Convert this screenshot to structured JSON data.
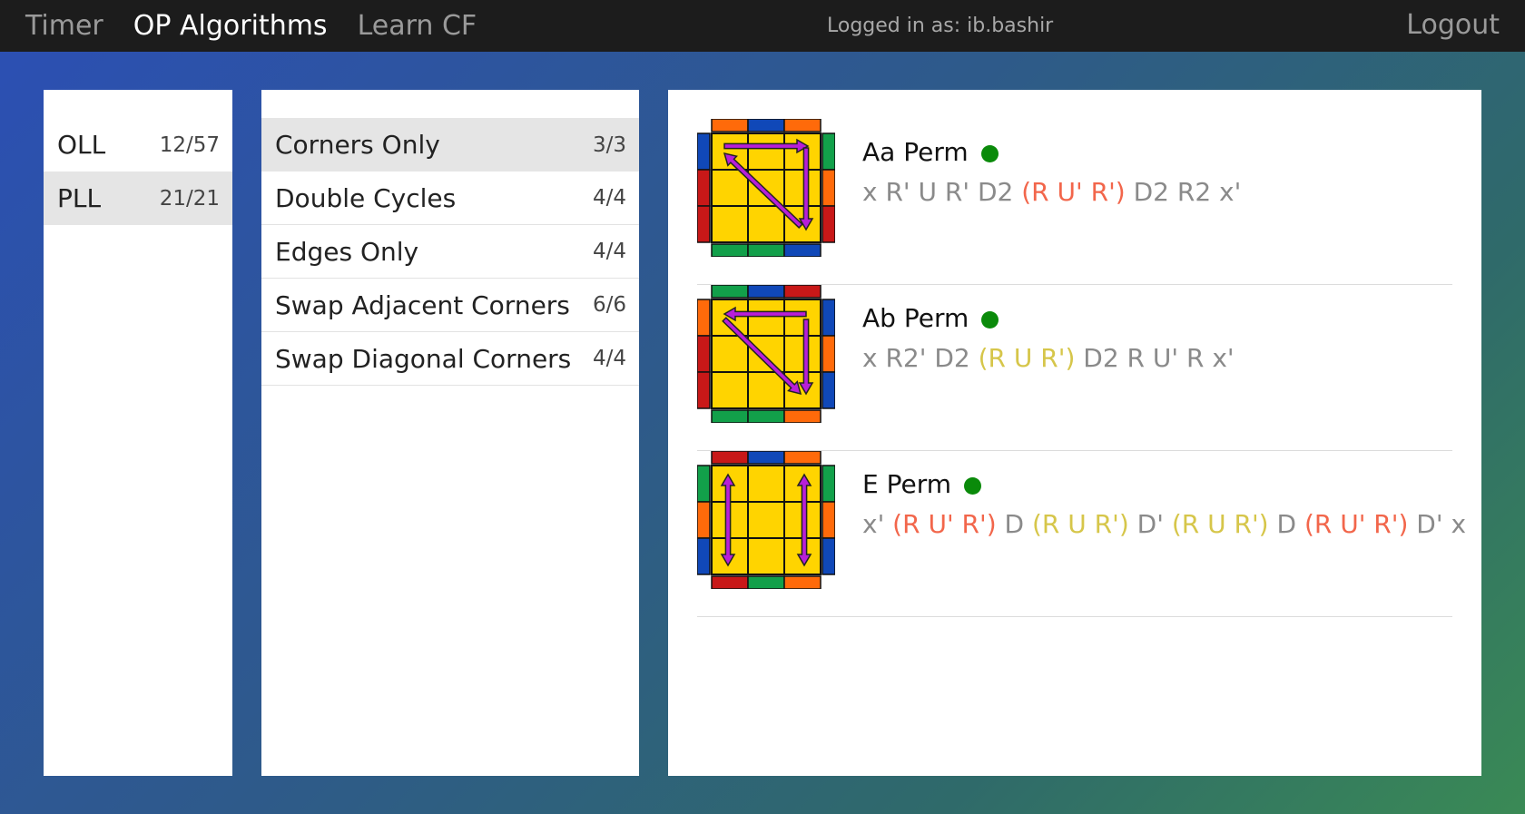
{
  "nav": {
    "items": [
      {
        "label": "Timer",
        "active": false
      },
      {
        "label": "OP Algorithms",
        "active": true
      },
      {
        "label": "Learn CF",
        "active": false
      }
    ],
    "logged_in_text": "Logged in as: ib.bashir",
    "logout_label": "Logout"
  },
  "sets": [
    {
      "name": "OLL",
      "count": "12/57",
      "selected": false
    },
    {
      "name": "PLL",
      "count": "21/21",
      "selected": true
    }
  ],
  "groups": [
    {
      "name": "Corners Only",
      "count": "3/3",
      "selected": true
    },
    {
      "name": "Double Cycles",
      "count": "4/4",
      "selected": false
    },
    {
      "name": "Edges Only",
      "count": "4/4",
      "selected": false
    },
    {
      "name": "Swap Adjacent Corners",
      "count": "6/6",
      "selected": false
    },
    {
      "name": "Swap Diagonal Corners",
      "count": "4/4",
      "selected": false
    }
  ],
  "colors": {
    "status_learned": "#0a8a0a",
    "highlight_orange": "#f2664b",
    "highlight_yellow": "#d6c64a",
    "moves_gray": "#8a8a8a",
    "cube_yellow": "#ffd400",
    "arrow": "#b81fd8",
    "red": "#c81818",
    "orange": "#ff6a0a",
    "blue": "#1048b8",
    "green": "#12a04a"
  },
  "algorithms": [
    {
      "name": "Aa Perm",
      "status_icon": "status-dot-icon",
      "segments": [
        {
          "text": "x R' U R' D2 ",
          "style": "gray"
        },
        {
          "text": "(R U' R')",
          "style": "orange"
        },
        {
          "text": " D2 R2 x'",
          "style": "gray"
        }
      ],
      "stickers": {
        "top": [
          "orange",
          "blue",
          "orange"
        ],
        "left": [
          "blue",
          "red",
          "red"
        ],
        "right": [
          "green",
          "orange",
          "red"
        ],
        "bottom": [
          "green",
          "green",
          "blue"
        ]
      },
      "arrows": "aa"
    },
    {
      "name": "Ab Perm",
      "status_icon": "status-dot-icon",
      "segments": [
        {
          "text": "x R2' D2 ",
          "style": "gray"
        },
        {
          "text": "(R U R')",
          "style": "yellow"
        },
        {
          "text": " D2 R U' R x'",
          "style": "gray"
        }
      ],
      "stickers": {
        "top": [
          "green",
          "blue",
          "red"
        ],
        "left": [
          "orange",
          "red",
          "red"
        ],
        "right": [
          "blue",
          "orange",
          "blue"
        ],
        "bottom": [
          "green",
          "green",
          "orange"
        ]
      },
      "arrows": "ab"
    },
    {
      "name": "E Perm",
      "status_icon": "status-dot-icon",
      "segments": [
        {
          "text": "x' ",
          "style": "gray"
        },
        {
          "text": "(R U' R')",
          "style": "orange"
        },
        {
          "text": " D ",
          "style": "gray"
        },
        {
          "text": "(R U R')",
          "style": "yellow"
        },
        {
          "text": " D' ",
          "style": "gray"
        },
        {
          "text": "(R U R')",
          "style": "yellow"
        },
        {
          "text": " D ",
          "style": "gray"
        },
        {
          "text": "(R U' R')",
          "style": "orange"
        },
        {
          "text": " D' x",
          "style": "gray"
        }
      ],
      "stickers": {
        "top": [
          "red",
          "blue",
          "orange"
        ],
        "left": [
          "green",
          "orange",
          "blue"
        ],
        "right": [
          "green",
          "orange",
          "blue"
        ],
        "bottom": [
          "red",
          "green",
          "orange"
        ]
      },
      "arrows": "e"
    }
  ]
}
